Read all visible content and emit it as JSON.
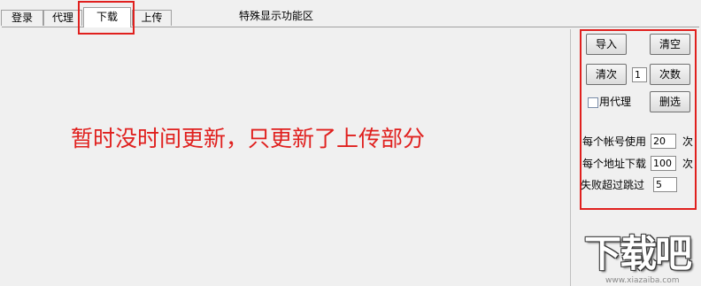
{
  "tabs": [
    {
      "label": "登录",
      "active": false
    },
    {
      "label": "代理",
      "active": false
    },
    {
      "label": "下载",
      "active": true
    },
    {
      "label": "上传",
      "active": false
    }
  ],
  "panel_title": "特殊显示功能区",
  "notice": "暂时没时间更新，只更新了上传部分",
  "controls": {
    "import_label": "导入",
    "clear_label": "清空",
    "clear_count_label": "清次",
    "count_value": "1",
    "count_label": "次数",
    "use_proxy_label": "用代理",
    "use_proxy_checked": false,
    "dedupe_label": "删选",
    "per_account_label": "每个帐号使用",
    "per_account_value": "20",
    "per_account_unit": "次",
    "per_url_label": "每个地址下载",
    "per_url_value": "100",
    "per_url_unit": "次",
    "fail_skip_label": "失败超过跳过",
    "fail_skip_value": "5"
  },
  "watermark": {
    "text": "下载吧",
    "url": "www.xiazaiba.com"
  },
  "colors": {
    "highlight": "#e0201e",
    "notice": "#e0201e",
    "background": "#f0f0f0"
  }
}
